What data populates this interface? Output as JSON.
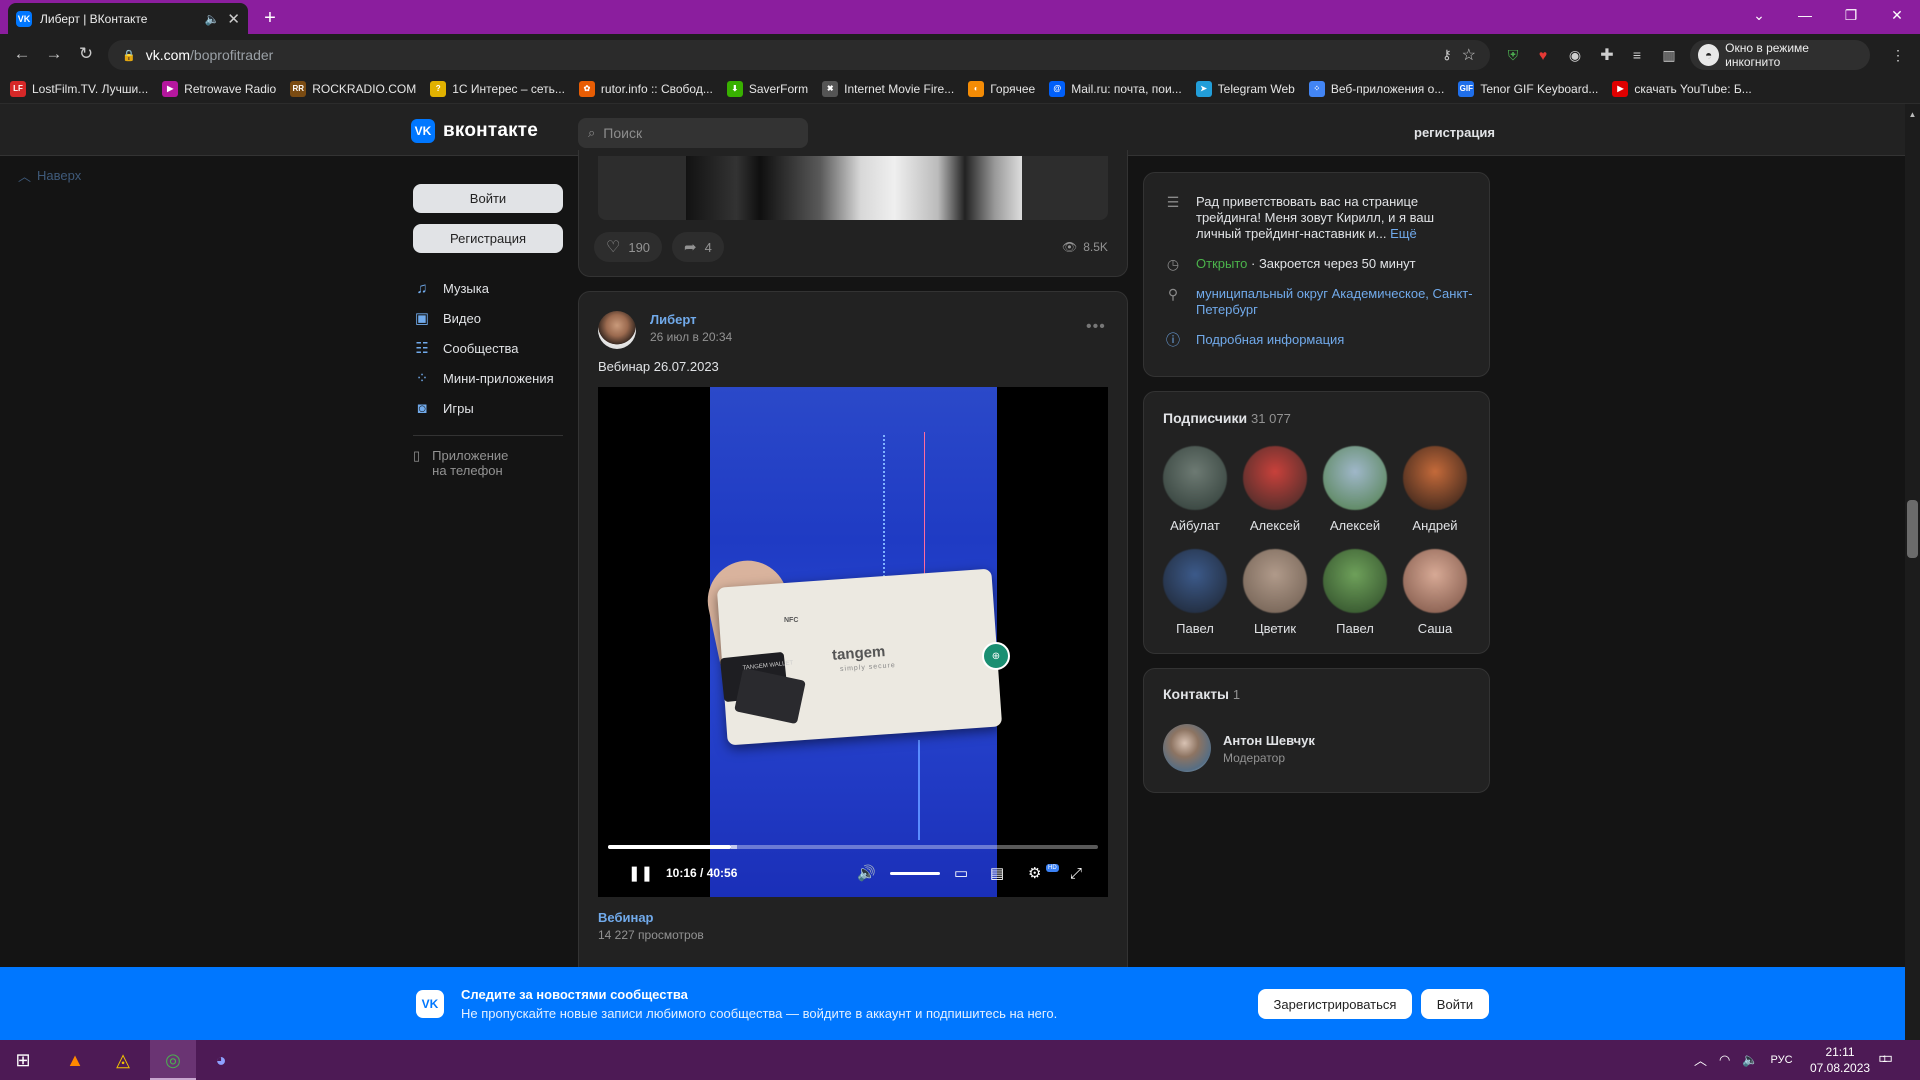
{
  "browser": {
    "tab_title": "Либерт | ВКонтакте",
    "new_tab": "+",
    "url_host": "vk.com",
    "url_path": "/boprofitrader",
    "incognito_label": "Окно в режиме инкогнито",
    "bookmarks": [
      {
        "label": "LostFilm.TV. Лучши...",
        "icon": "LF",
        "color": "#d62828"
      },
      {
        "label": "Retrowave Radio",
        "icon": "▶",
        "color": "#b5179e"
      },
      {
        "label": "ROCKRADIO.COM",
        "icon": "RR",
        "color": "#7a4b12"
      },
      {
        "label": "1С Интерес – сеть...",
        "icon": "?",
        "color": "#e0b100"
      },
      {
        "label": "rutor.info :: Свобод...",
        "icon": "✿",
        "color": "#e85d04"
      },
      {
        "label": "SaverForm",
        "icon": "⬇",
        "color": "#38b000"
      },
      {
        "label": "Internet Movie Fire...",
        "icon": "✖",
        "color": "#555555"
      },
      {
        "label": "Горячее",
        "icon": "◐",
        "color": "#f48c06"
      },
      {
        "label": "Mail.ru: почта, пои...",
        "icon": "@",
        "color": "#005ff9"
      },
      {
        "label": "Telegram Web",
        "icon": "➤",
        "color": "#229ed9"
      },
      {
        "label": "Веб-приложения о...",
        "icon": "⁘",
        "color": "#4285f4"
      },
      {
        "label": "Tenor GIF Keyboard...",
        "icon": "GIF",
        "color": "#1f6feb"
      },
      {
        "label": "скачать YouTube: Б...",
        "icon": "▶",
        "color": "#e00000"
      }
    ]
  },
  "vk": {
    "logo_text": "вконтакте",
    "search_placeholder": "Поиск",
    "register_link": "регистрация",
    "back_to_top": "Наверх"
  },
  "left_menu": {
    "login_button": "Войти",
    "register_button": "Регистрация",
    "items": [
      {
        "label": "Музыка",
        "icon": "music-icon"
      },
      {
        "label": "Видео",
        "icon": "video-icon"
      },
      {
        "label": "Сообщества",
        "icon": "communities-icon"
      },
      {
        "label": "Мини-приложения",
        "icon": "mini-apps-icon"
      },
      {
        "label": "Игры",
        "icon": "games-icon"
      }
    ],
    "phone_app_line1": "Приложение",
    "phone_app_line2": "на телефон"
  },
  "post1": {
    "likes": "190",
    "shares": "4",
    "views": "8.5K"
  },
  "post2": {
    "author": "Либерт",
    "date": "26 июл в 20:34",
    "text": "Вебинар 26.07.2023",
    "video": {
      "time": "10:16 / 40:56",
      "progress": 0.25,
      "brand": "tangem",
      "brand_sub": "simply secure",
      "nfc": "NFC",
      "card_text": "TANGEM WALLET",
      "hd_badge": "HD"
    },
    "video_title": "Вебинар",
    "video_views": "14 227 просмотров"
  },
  "info": {
    "description": "Рад приветствовать вас на странице трейдинга! Меня зовут Кирилл, и я ваш личный трейдинг-наставник и...",
    "more": "Ещё",
    "open_status": "Открыто",
    "closes": "· Закроется через 50 минут",
    "location": "муниципальный округ Академическое, Санкт-Петербург",
    "details": "Подробная информация"
  },
  "subscribers": {
    "title": "Подписчики",
    "count": "31 077",
    "items": [
      {
        "name": "Айбулат",
        "colors": [
          "#6d7a73",
          "#2e3b36"
        ]
      },
      {
        "name": "Алексей",
        "colors": [
          "#c8413b",
          "#3a2a28"
        ]
      },
      {
        "name": "Алексей",
        "colors": [
          "#9fb7c9",
          "#4f7e4a"
        ]
      },
      {
        "name": "Андрей",
        "colors": [
          "#c46a3a",
          "#2a1d18"
        ]
      },
      {
        "name": "Павел",
        "colors": [
          "#3c5a8a",
          "#1d2430"
        ]
      },
      {
        "name": "Цветик",
        "colors": [
          "#b09a8a",
          "#6d5c4f"
        ]
      },
      {
        "name": "Павел",
        "colors": [
          "#6ea05a",
          "#2d4a28"
        ]
      },
      {
        "name": "Саша",
        "colors": [
          "#d7a995",
          "#7a5244"
        ]
      }
    ]
  },
  "contacts": {
    "title": "Контакты",
    "count": "1",
    "name": "Антон Шевчук",
    "role": "Модератор"
  },
  "bottom_banner": {
    "title": "Следите за новостями сообщества",
    "subtitle": "Не пропускайте новые записи любимого сообщества — войдите в аккаунт и подпишитесь на него.",
    "register_button": "Зарегистрироваться",
    "login_button": "Войти"
  },
  "taskbar": {
    "lang": "РУС",
    "time": "21:11",
    "date": "07.08.2023",
    "notifications": "1"
  }
}
